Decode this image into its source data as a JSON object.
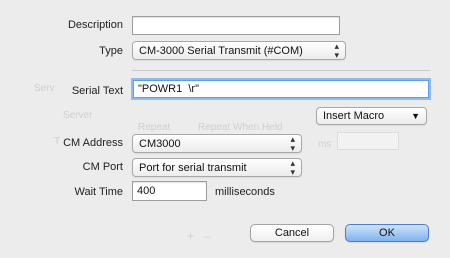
{
  "form": {
    "description": {
      "label": "Description",
      "value": ""
    },
    "type": {
      "label": "Type",
      "value": "CM-3000 Serial Transmit (#COM)"
    },
    "serial_text": {
      "label": "Serial Text",
      "value": "\"POWR1  \\r\""
    },
    "insert_macro": {
      "label": "Insert Macro"
    },
    "cm_address": {
      "label": "CM Address",
      "value": "CM3000"
    },
    "cm_port": {
      "label": "CM Port",
      "value": "Port for serial transmit"
    },
    "wait_time": {
      "label": "Wait Time",
      "value": "400",
      "unit": "milliseconds"
    }
  },
  "buttons": {
    "cancel": "Cancel",
    "ok": "OK"
  },
  "background_ghost": {
    "serv": "Serv",
    "server": "Server",
    "t": "T",
    "repeat": "Repeat",
    "repeat_when_held": "Repeat When Held",
    "ms": "ms",
    "plus": "+",
    "minus": "–"
  }
}
